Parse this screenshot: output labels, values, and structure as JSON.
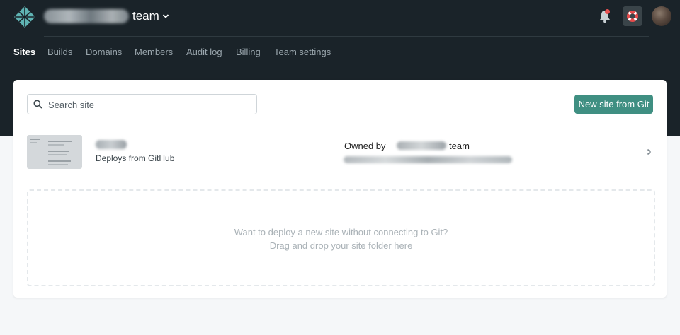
{
  "header": {
    "team_suffix": "team",
    "icons": {
      "logo": "netlify-logo-icon",
      "team_dropdown": "chevron-down-icon",
      "notifications": "bell-icon",
      "help": "lifebuoy-icon",
      "avatar": "user-avatar"
    }
  },
  "nav": {
    "items": [
      {
        "label": "Sites",
        "active": true
      },
      {
        "label": "Builds"
      },
      {
        "label": "Domains"
      },
      {
        "label": "Members"
      },
      {
        "label": "Audit log"
      },
      {
        "label": "Billing"
      },
      {
        "label": "Team settings"
      }
    ]
  },
  "search": {
    "placeholder": "Search site",
    "value": ""
  },
  "actions": {
    "new_site_label": "New site from Git"
  },
  "sites": [
    {
      "deploy_source": "Deploys from GitHub",
      "owned_by_prefix": "Owned by",
      "owned_by_suffix": "team"
    }
  ],
  "dropzone": {
    "line1": "Want to deploy a new site without connecting to Git?",
    "line2": "Drag and drop your site folder here"
  },
  "colors": {
    "header_bg": "#1a2329",
    "accent": "#3f8f82",
    "logo": "#5fb3b3",
    "notification_dot": "#e85252"
  }
}
